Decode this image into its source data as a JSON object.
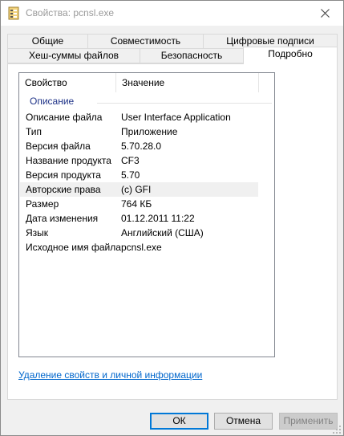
{
  "window": {
    "title": "Свойства: pcnsl.exe"
  },
  "tabs": {
    "row1": [
      {
        "label": "Общие"
      },
      {
        "label": "Совместимость"
      },
      {
        "label": "Цифровые подписи"
      }
    ],
    "row2": [
      {
        "label": "Хеш-суммы файлов"
      },
      {
        "label": "Безопасность"
      },
      {
        "label": "Подробно"
      }
    ],
    "active": "Подробно"
  },
  "details": {
    "columns": {
      "property": "Свойство",
      "value": "Значение"
    },
    "group": "Описание",
    "rows": [
      {
        "prop": "Описание файла",
        "val": "User Interface Application"
      },
      {
        "prop": "Тип",
        "val": "Приложение"
      },
      {
        "prop": "Версия файла",
        "val": "5.70.28.0"
      },
      {
        "prop": "Название продукта",
        "val": "CF3"
      },
      {
        "prop": "Версия продукта",
        "val": "5.70"
      },
      {
        "prop": "Авторские права",
        "val": "(c) GFI"
      },
      {
        "prop": "Размер",
        "val": "764 КБ"
      },
      {
        "prop": "Дата изменения",
        "val": "01.12.2011 11:22"
      },
      {
        "prop": "Язык",
        "val": "Английский (США)"
      },
      {
        "prop": "Исходное имя файла",
        "val": "pcnsl.exe"
      }
    ],
    "selected_row": "Авторские права"
  },
  "links": {
    "remove_properties": "Удаление свойств и личной информации"
  },
  "buttons": {
    "ok": "ОК",
    "cancel": "Отмена",
    "apply": "Применить"
  },
  "icons": {
    "title": "properties-file-icon",
    "close": "close-icon",
    "grip": "resize-grip-icon"
  }
}
